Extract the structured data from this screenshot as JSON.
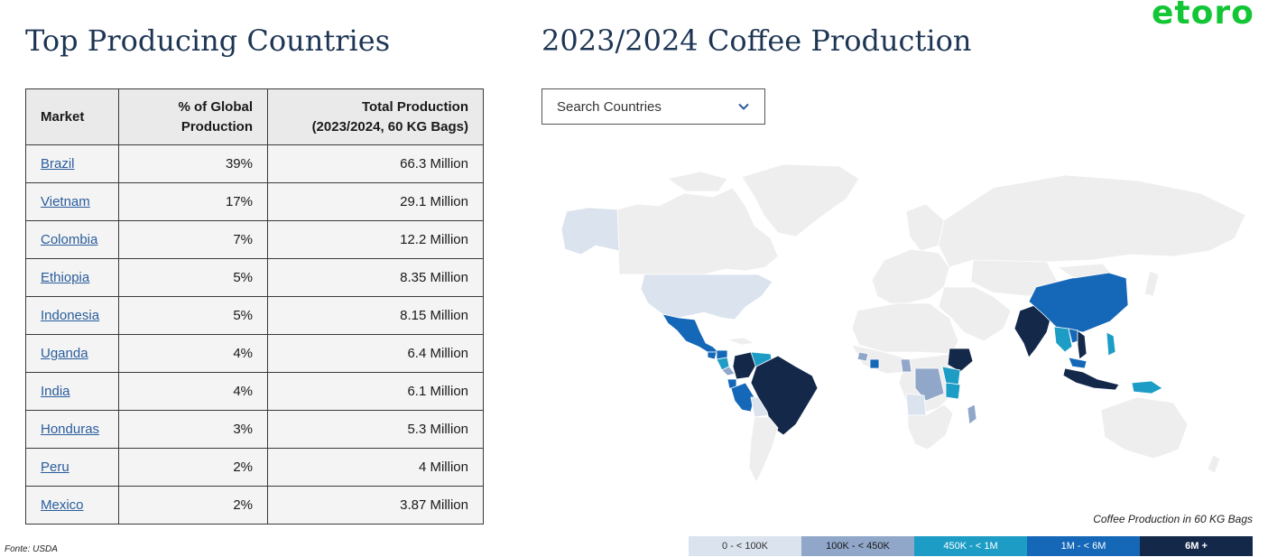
{
  "left_title": "Top Producing Countries",
  "right_title": "2023/2024 Coffee Production",
  "logo_text": "etoro",
  "table": {
    "headers": {
      "market": "Market",
      "share_line1": "% of Global",
      "share_line2": "Production",
      "total_line1": "Total Production",
      "total_line2": "(2023/2024, 60 KG Bags)"
    },
    "rows": [
      {
        "market": "Brazil",
        "share": "39%",
        "total": "66.3 Million"
      },
      {
        "market": "Vietnam",
        "share": "17%",
        "total": "29.1 Million"
      },
      {
        "market": "Colombia",
        "share": "7%",
        "total": "12.2 Million"
      },
      {
        "market": "Ethiopia",
        "share": "5%",
        "total": "8.35 Million"
      },
      {
        "market": "Indonesia",
        "share": "5%",
        "total": "8.15 Million"
      },
      {
        "market": "Uganda",
        "share": "4%",
        "total": "6.4 Million"
      },
      {
        "market": "India",
        "share": "4%",
        "total": "6.1 Million"
      },
      {
        "market": "Honduras",
        "share": "3%",
        "total": "5.3 Million"
      },
      {
        "market": "Peru",
        "share": "2%",
        "total": "4 Million"
      },
      {
        "market": "Mexico",
        "share": "2%",
        "total": "3.87 Million"
      }
    ]
  },
  "source": "Fonte: USDA",
  "search": {
    "placeholder": "Search Countries",
    "icon": "chevron-down-icon"
  },
  "legend": {
    "caption": "Coffee Production in 60 KG Bags",
    "bins": [
      {
        "label": "0 - < 100K",
        "color": "#dbe3ee",
        "text_color": "#333333"
      },
      {
        "label": "100K - < 450K",
        "color": "#90a7c9",
        "text_color": "#1a1a1a"
      },
      {
        "label": "450K - < 1M",
        "color": "#1d9dc6",
        "text_color": "#ffffff"
      },
      {
        "label": "1M - < 6M",
        "color": "#1567b8",
        "text_color": "#ffffff"
      },
      {
        "label": "6M +",
        "color": "#14294a",
        "text_color": "#ffffff"
      }
    ]
  },
  "colors": {
    "title": "#1d3554",
    "logo": "#13c636",
    "link": "#2a5d9c",
    "land_default": "#eeeeee",
    "land_border": "#ffffff"
  }
}
